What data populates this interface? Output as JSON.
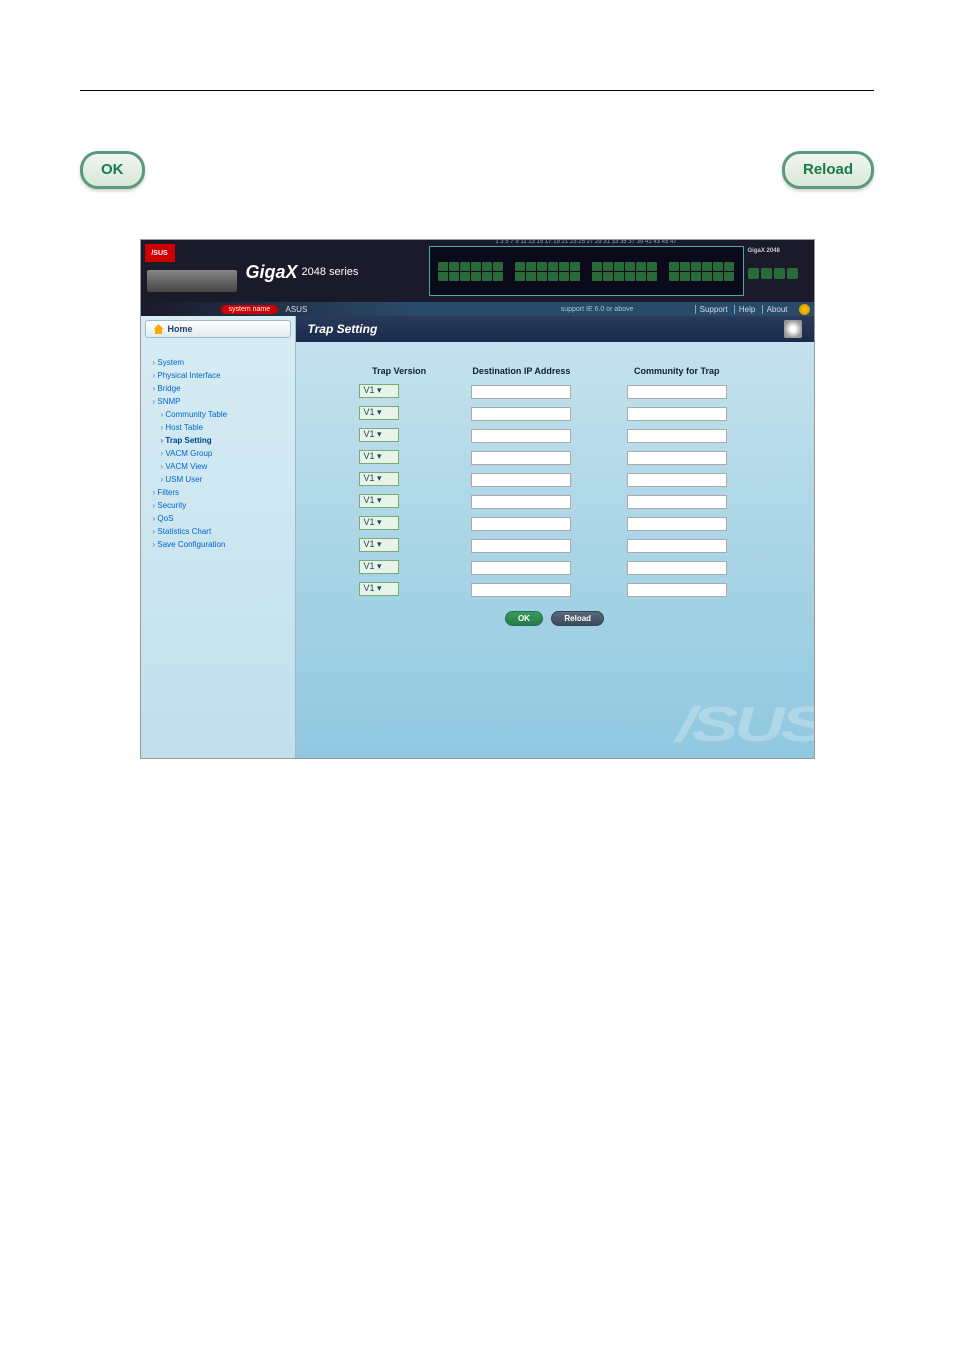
{
  "buttons": {
    "ok": "OK",
    "reload": "Reload"
  },
  "banner": {
    "logo": "/SUS",
    "product": "GigaX",
    "series": "2048 series",
    "model_right": "GigaX 2048"
  },
  "sysbar": {
    "label": "system name",
    "value": "ASUS",
    "note": "support IE 6.0 or above",
    "links": [
      "Support",
      "Help",
      "About"
    ]
  },
  "port_numbers_top": "1  3  5  7  9  11  13  15  17  19  21  23     25  27  29  31  33  35     37  39  41  43  45  47",
  "sidebar": {
    "home": "Home",
    "items": [
      {
        "label": "System",
        "sub": false
      },
      {
        "label": "Physical Interface",
        "sub": false
      },
      {
        "label": "Bridge",
        "sub": false
      },
      {
        "label": "SNMP",
        "sub": false
      },
      {
        "label": "Community Table",
        "sub": true
      },
      {
        "label": "Host Table",
        "sub": true
      },
      {
        "label": "Trap Setting",
        "sub": true,
        "active": true
      },
      {
        "label": "VACM Group",
        "sub": true
      },
      {
        "label": "VACM View",
        "sub": true
      },
      {
        "label": "USM User",
        "sub": true
      },
      {
        "label": "Filters",
        "sub": false
      },
      {
        "label": "Security",
        "sub": false
      },
      {
        "label": "QoS",
        "sub": false
      },
      {
        "label": "Statistics Chart",
        "sub": false
      },
      {
        "label": "Save Configuration",
        "sub": false
      }
    ]
  },
  "panel": {
    "title": "Trap Setting",
    "columns": [
      "Trap Version",
      "Destination IP Address",
      "Community for Trap"
    ],
    "rows": [
      {
        "version": "V1",
        "ip": "",
        "community": ""
      },
      {
        "version": "V1",
        "ip": "",
        "community": ""
      },
      {
        "version": "V1",
        "ip": "",
        "community": ""
      },
      {
        "version": "V1",
        "ip": "",
        "community": ""
      },
      {
        "version": "V1",
        "ip": "",
        "community": ""
      },
      {
        "version": "V1",
        "ip": "",
        "community": ""
      },
      {
        "version": "V1",
        "ip": "",
        "community": ""
      },
      {
        "version": "V1",
        "ip": "",
        "community": ""
      },
      {
        "version": "V1",
        "ip": "",
        "community": ""
      },
      {
        "version": "V1",
        "ip": "",
        "community": ""
      }
    ],
    "ok": "OK",
    "reload": "Reload"
  },
  "watermark": "/SUS"
}
